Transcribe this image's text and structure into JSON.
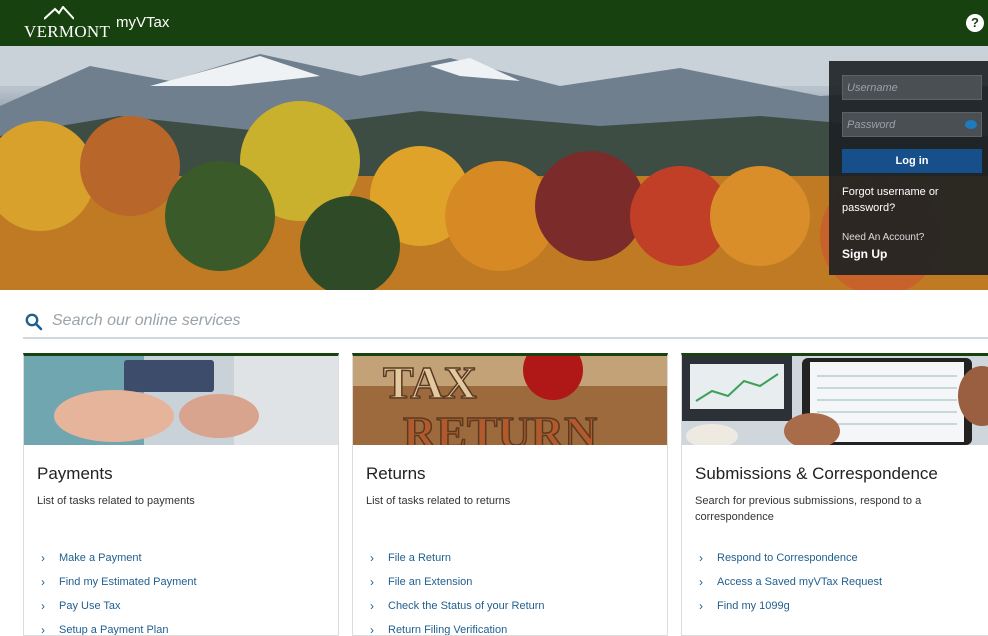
{
  "header": {
    "logo_text": "VERMONT",
    "app_title": "myVTax",
    "help_glyph": "?"
  },
  "login": {
    "username_placeholder": "Username",
    "password_placeholder": "Password",
    "login_label": "Log in",
    "forgot_label": "Forgot username or password?",
    "need_account": "Need An Account?",
    "signup_label": "Sign Up"
  },
  "search": {
    "placeholder": "Search our online services"
  },
  "cards": [
    {
      "title": "Payments",
      "desc": "List of tasks related to payments",
      "links": [
        "Make a Payment",
        "Find my Estimated Payment",
        "Pay Use Tax",
        "Setup a Payment Plan"
      ]
    },
    {
      "title": "Returns",
      "desc": "List of tasks related to returns",
      "links": [
        "File a Return",
        "File an Extension",
        "Check the Status of your Return",
        "Return Filing Verification"
      ]
    },
    {
      "title": "Submissions & Correspondence",
      "desc": "Search for previous submissions, respond to a correspondence",
      "links": [
        "Respond to Correspondence",
        "Access a Saved myVTax Request",
        "Find my 1099g"
      ]
    }
  ],
  "image_text": {
    "tax_banner": "TAX RETURN"
  },
  "colors": {
    "header_green": "#17410f",
    "login_button": "#174f8a",
    "link_blue": "#1f5f8f"
  }
}
